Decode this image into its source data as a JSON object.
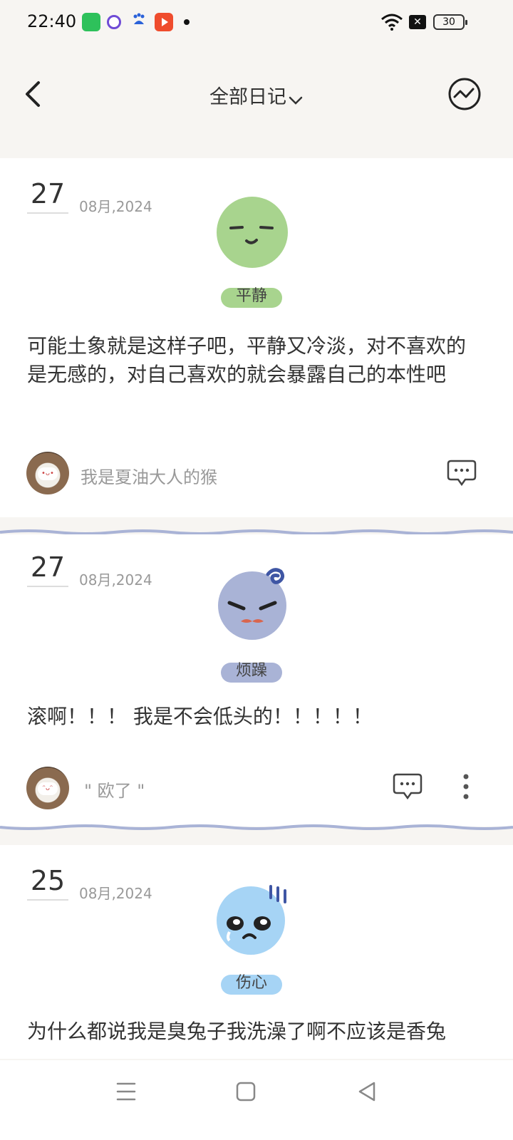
{
  "status_bar": {
    "time": "22:40",
    "battery": "30",
    "icons": [
      "app-icon-green",
      "app-icon-purple",
      "baidu-icon",
      "video-app-icon",
      "notification-dot",
      "wifi-icon",
      "sim-off-icon",
      "battery-icon"
    ]
  },
  "header": {
    "title": "全部日记",
    "back_icon": "chevron-left-icon",
    "title_icon": "chevron-down-icon",
    "stats_icon": "trend-chart-icon"
  },
  "entries": [
    {
      "day": "27",
      "month_year": "08月,2024",
      "mood": "平静",
      "mood_color": "#a8d48e",
      "text": "可能土象就是这样子吧，平静又冷淡，对不喜欢的是无感的，对自己喜欢的就会暴露自己的本性吧",
      "author": "我是夏油大人的猴"
    },
    {
      "day": "27",
      "month_year": "08月,2024",
      "mood": "烦躁",
      "mood_color": "#a9b3d6",
      "text": "滚啊！！！ 我是不会低头的！！！！！",
      "author": "\" 欧了 \""
    },
    {
      "day": "25",
      "month_year": "08月,2024",
      "mood": "伤心",
      "mood_color": "#a6d4f5",
      "text": "为什么都说我是臭兔子我洗澡了啊不应该是香兔"
    }
  ],
  "nav_bar": {
    "icons": [
      "menu-icon",
      "home-square-icon",
      "back-triangle-icon"
    ]
  }
}
